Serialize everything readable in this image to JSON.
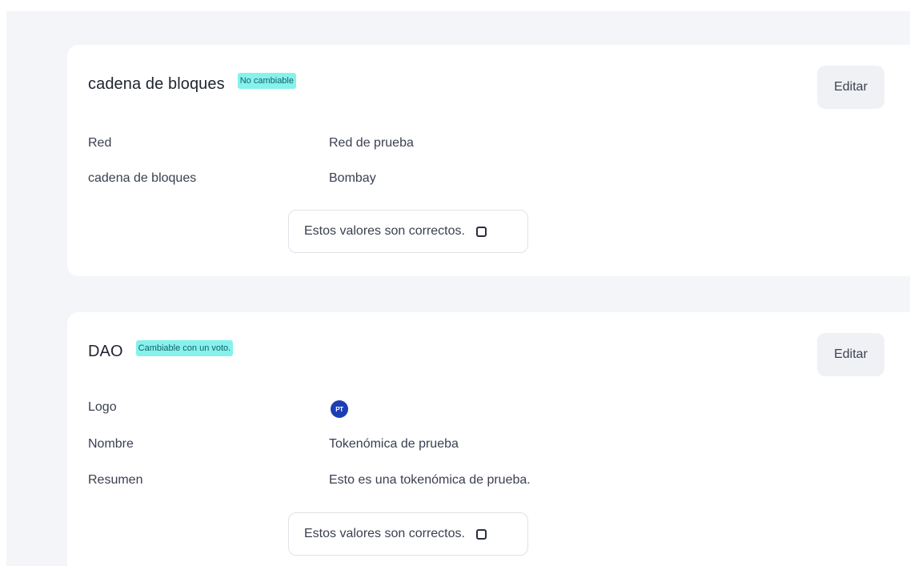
{
  "sections": [
    {
      "title": "cadena de bloques",
      "badge": "No cambiable",
      "edit_label": "Editar",
      "fields": [
        {
          "label": "Red",
          "value": "Red de prueba"
        },
        {
          "label": "cadena de bloques",
          "value": "Bombay"
        }
      ],
      "confirm_label": "Estos valores son correctos."
    },
    {
      "title": "DAO",
      "badge": "Cambiable con un voto.",
      "edit_label": "Editar",
      "fields": [
        {
          "label": "Logo",
          "value": "PT"
        },
        {
          "label": "Nombre",
          "value": "Tokenómica de prueba"
        },
        {
          "label": "Resumen",
          "value": "Esto es una tokenómica de prueba."
        }
      ],
      "confirm_label": "Estos valores son correctos."
    }
  ],
  "colors": {
    "badge_bg": "#86f2ec",
    "avatar_bg": "#1b3db5",
    "page_bg": "#f4f5f8"
  }
}
